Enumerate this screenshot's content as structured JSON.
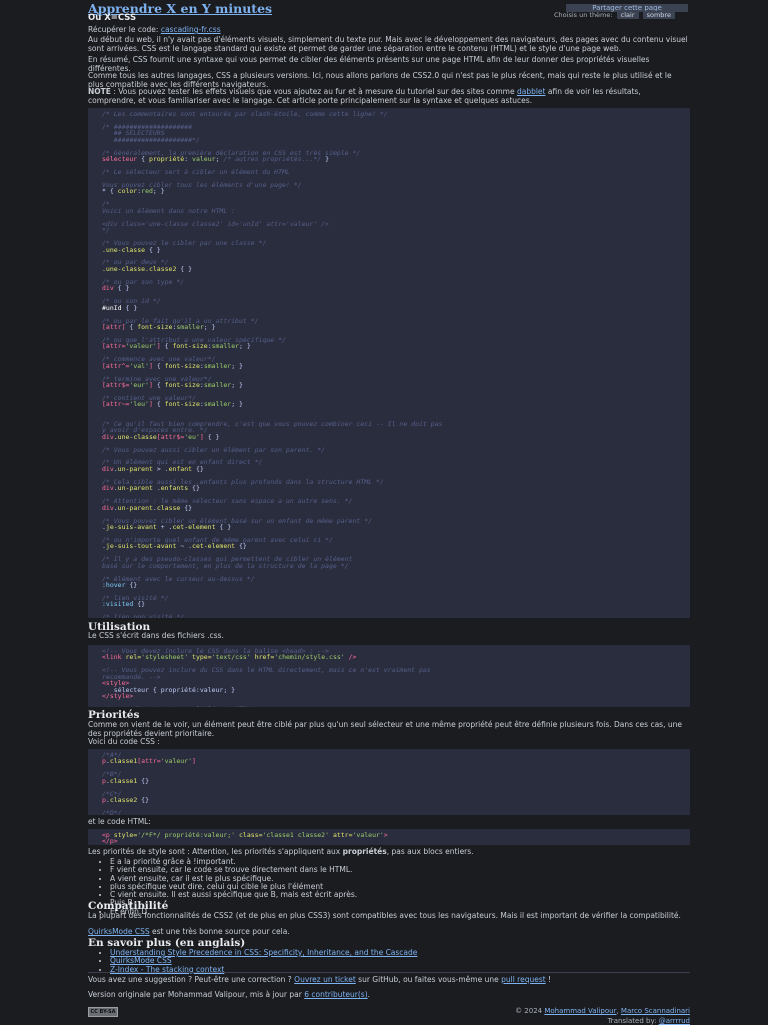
{
  "header": {
    "title": "Apprendre X en Y minutes",
    "share": "Partager cette page",
    "theme_label": "Choisis un thème:",
    "theme_light": "clair",
    "theme_dark": "sombre"
  },
  "subtitle": "Où X=CSS",
  "source_prefix": "Récupérer le code: ",
  "source_link": "cascading-fr.css",
  "intro": [
    "Au début du web, il n'y avait pas d'éléments visuels, simplement du texte pur. Mais avec le développement des navigateurs, des pages avec du contenu visuel sont arrivées. CSS est le langage standard qui existe et permet de garder une séparation entre le contenu (HTML) et le style d'une page web.",
    "En résumé, CSS fournit une syntaxe qui vous permet de cibler des éléments présents sur une page HTML afin de leur donner des propriétés visuelles différentes.",
    "Comme tous les autres langages, CSS a plusieurs versions. Ici, nous allons parlons de CSS2.0 qui n'est pas le plus récent, mais qui reste le plus utilisé et le plus compatible avec les différents navigateurs."
  ],
  "note": {
    "label": "NOTE",
    "before": " : Vous pouvez tester les effets visuels que vous ajoutez au fur et à mesure du tutoriel sur des sites comme ",
    "link": "dabblet",
    "after": " afin de voir les résultats, comprendre, et vous familiariser avec le langage. Cet article porte principalement sur la syntaxe et quelques astuces."
  },
  "sections": {
    "usage_title": "Utilisation",
    "usage_text": "Le CSS s'écrit dans des fichiers .css.",
    "priority_title": "Priorités",
    "priority_text": "Comme on vient de le voir, un élément peut être ciblé par plus qu'un seul sélecteur et une même propriété peut être définie plusieurs fois. Dans ces cas, une des propriétés devient prioritaire.",
    "priority_code_intro": "Voici du code CSS :",
    "html_intro": "et le code HTML:",
    "priority_order_before": "Les priorités de style sont : Attention, les priorités s'appliquent aux ",
    "priority_order_bold": "propriétés",
    "priority_order_after": ", pas aux blocs entiers.",
    "compat_title": "Compatibilité",
    "compat_text": "La plupart des fonctionnalités de CSS2 (et de plus en plus CSS3) sont compatibles avec tous les navigateurs. Mais il est important de vérifier la compatibilité.",
    "compat_link": "QuirksMode CSS",
    "compat_link_after": " est une très bonne source pour cela.",
    "more_title": "En savoir plus (en anglais)"
  },
  "priority_list": [
    "E a la priorité grâce à !important.",
    "F vient ensuite, car le code se trouve directement dans le HTML.",
    "A vient ensuite, car il est le plus spécifique.",
    "plus spécifique veut dire, celui qui cible le plus l'élément",
    "C vient ensuite. Il est aussi spécifique que B, mais est écrit après.",
    "Puis B",
    "Et enfin D."
  ],
  "more_links": [
    "Understanding Style Precedence in CSS: Specificity, Inheritance, and the Cascade",
    "QuirksMode CSS",
    "Z-Index - The stacking context"
  ],
  "footer": {
    "suggest_before": "Vous avez une suggestion ? Peut-être une correction ? ",
    "suggest_link": "Ouvrez un ticket",
    "suggest_mid": " sur GitHub, ou faites vous-même une ",
    "suggest_link2": "pull request",
    "suggest_after": " !",
    "original_before": "Version originale par Mohammad Valipour, mis à jour par ",
    "original_link": "6 contributeur(s)",
    "original_after": ".",
    "license_badge": "CC BY-SA",
    "copyright_before": "© 2024 ",
    "author1": "Mohammad Valipour",
    "sep": ", ",
    "author2": "Marco Scannadinari",
    "translated_before": "Translated by: ",
    "translator": "@arrrrud"
  }
}
